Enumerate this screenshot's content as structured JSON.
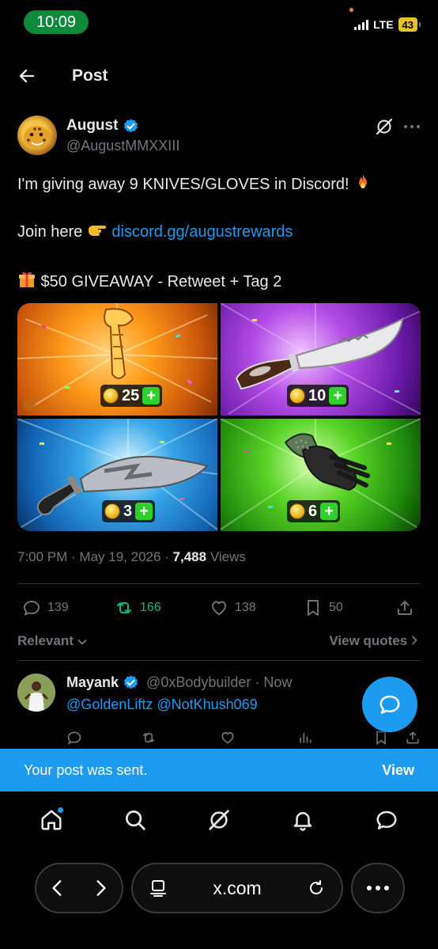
{
  "status_bar": {
    "time": "10:09",
    "network": "LTE",
    "battery": "43"
  },
  "header": {
    "title": "Post"
  },
  "post": {
    "author_name": "August",
    "author_handle": "@AugustMMXXIII",
    "line1": "I'm giving away 9 KNIVES/GLOVES in Discord! ",
    "line2_prefix": "Join here ",
    "line2_link": "discord.gg/augustrewards",
    "line3": " $50 GIVEAWAY - Retweet + Tag 2",
    "media": [
      {
        "amount": "25",
        "color": "#ff9a1a"
      },
      {
        "amount": "10",
        "color": "#b44de6"
      },
      {
        "amount": "3",
        "color": "#37a6e8"
      },
      {
        "amount": "6",
        "color": "#59d326"
      }
    ],
    "timestamp": "7:00 PM · May 19, 2026 · ",
    "views_count": "7,488",
    "views_label": " Views",
    "stats": {
      "replies": "139",
      "reposts": "166",
      "likes": "138",
      "bookmarks": "50"
    }
  },
  "filters": {
    "relevant": "Relevant",
    "view_quotes": "View quotes"
  },
  "reply": {
    "name": "Mayank",
    "handle": "@0xBodybuilder · Now",
    "text": "@GoldenLiftz @NotKhush069"
  },
  "toast": {
    "message": "Your post was sent.",
    "action": "View"
  },
  "bottom_nav": [
    "home-icon",
    "search-icon",
    "grok-icon",
    "notifications-icon",
    "messages-icon"
  ],
  "browser": {
    "url": "x.com"
  },
  "colors": {
    "accent": "#1d9bf0",
    "repost_green": "#00ba7c",
    "background": "#000000",
    "muted": "#71767b"
  }
}
